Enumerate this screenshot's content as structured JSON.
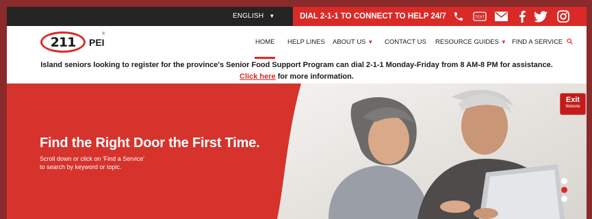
{
  "colors": {
    "brand_red": "#d92a27",
    "topbar_dark": "#242424",
    "hero_red": "#d6332c",
    "frame": "#8a2a2a"
  },
  "topbar": {
    "language": "ENGLISH",
    "dial_text": "DIAL 2-1-1 TO CONNECT TO HELP 24/7",
    "text_icon_label": "TEXT",
    "icons": [
      "phone-icon",
      "text-icon",
      "mail-icon",
      "facebook-icon",
      "twitter-icon",
      "instagram-icon"
    ]
  },
  "logo": {
    "number": "211",
    "name": "PEI",
    "reg": "®"
  },
  "nav": {
    "home": "HOME",
    "help_lines": "HELP LINES",
    "about_us": "ABOUT US",
    "contact_us": "CONTACT US",
    "resource_guides": "RESOURCE GUIDES",
    "find_service": "FIND A SERVICE"
  },
  "announcement": {
    "text": "Island seniors looking to register for the province's Senior Food Support Program can dial 2-1-1 Monday-Friday from 8 AM-8 PM for assistance.",
    "link_text": "Click here",
    "suffix": "for more information."
  },
  "hero": {
    "title": "Find the Right Door the First Time.",
    "subtitle_line1": "Scroll down or click on 'Find a Service'",
    "subtitle_line2": "to search by keyword or topic.",
    "exit_label": "Exit",
    "exit_sub": "Website",
    "slides": 3,
    "active_slide": 2
  }
}
